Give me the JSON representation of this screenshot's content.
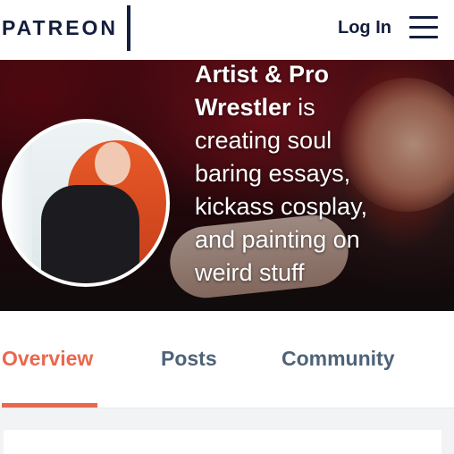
{
  "brand": {
    "logo": "PATREON"
  },
  "header": {
    "login_label": "Log In",
    "menu_icon": "hamburger-menu-icon"
  },
  "hero": {
    "creator_name_line1": "Artist & Pro",
    "creator_name_line2": "Wrestler",
    "is_text": " is",
    "description_lines": [
      "creating soul",
      "baring essays,",
      "kickass cosplay,",
      "and painting on",
      "weird stuff"
    ]
  },
  "tabs": [
    {
      "label": "Overview",
      "active": true
    },
    {
      "label": "Posts",
      "active": false
    },
    {
      "label": "Community",
      "active": false
    }
  ],
  "colors": {
    "brand_navy": "#141e3c",
    "accent_coral": "#e9684e",
    "tab_inactive": "#4e6378"
  }
}
